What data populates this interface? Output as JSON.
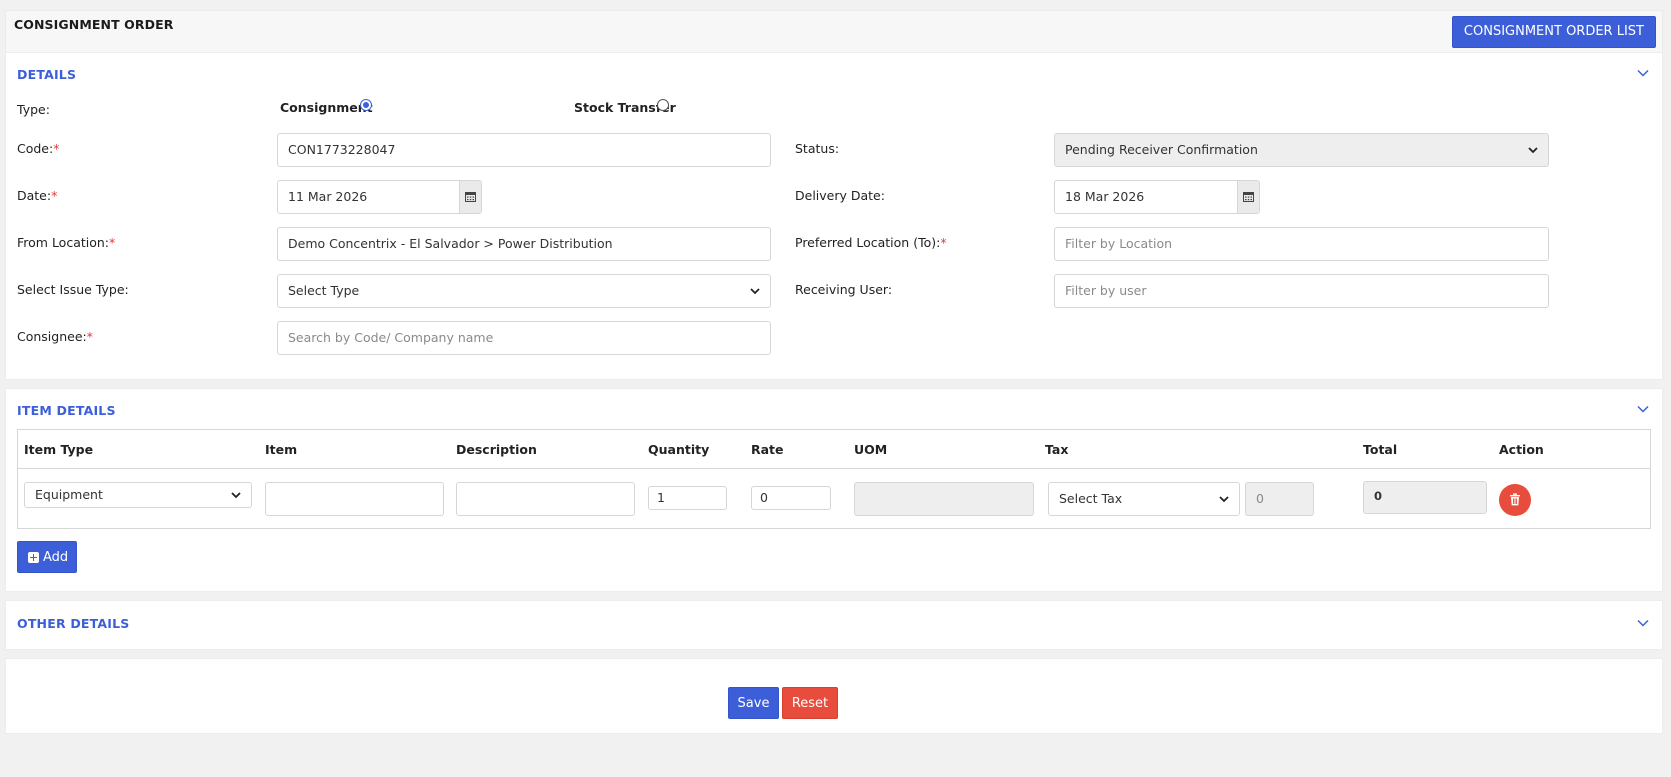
{
  "header": {
    "title": "CONSIGNMENT ORDER",
    "list_button": "CONSIGNMENT ORDER LIST"
  },
  "details": {
    "title": "DETAILS",
    "type_label": "Type:",
    "type_options": [
      "Consignment",
      "Stock Transfer"
    ],
    "type_selected": "Consignment",
    "code_label": "Code:",
    "code_value": "CON1773228047",
    "status_label": "Status:",
    "status_value": "Pending Receiver Confirmation",
    "date_label": "Date:",
    "date_value": "11 Mar 2026",
    "delivery_label": "Delivery Date:",
    "delivery_value": "18 Mar 2026",
    "from_label": "From Location:",
    "from_value": "Demo Concentrix - El Salvador > Power Distribution",
    "pref_label": "Preferred Location (To):",
    "pref_placeholder": "Filter by Location",
    "issue_label": "Select Issue Type:",
    "issue_value": "Select Type",
    "recv_label": "Receiving User:",
    "recv_placeholder": "Filter by user",
    "consignee_label": "Consignee:",
    "consignee_placeholder": "Search by Code/ Company name",
    "required_mark": "*"
  },
  "items": {
    "title": "ITEM DETAILS",
    "columns": [
      "Item Type",
      "Item",
      "Description",
      "Quantity",
      "Rate",
      "UOM",
      "Tax",
      "Total",
      "Action"
    ],
    "row": {
      "item_type": "Equipment",
      "item": "",
      "description": "",
      "quantity": "1",
      "rate": "0",
      "uom": "",
      "tax": "Select Tax",
      "tax_value": "0",
      "total": "0"
    },
    "add_label": "Add"
  },
  "other": {
    "title": "OTHER DETAILS"
  },
  "footer": {
    "save_label": "Save",
    "reset_label": "Reset"
  },
  "colors": {
    "primary": "#3c5fd9",
    "danger": "#e74c3c",
    "required": "#e53935"
  }
}
